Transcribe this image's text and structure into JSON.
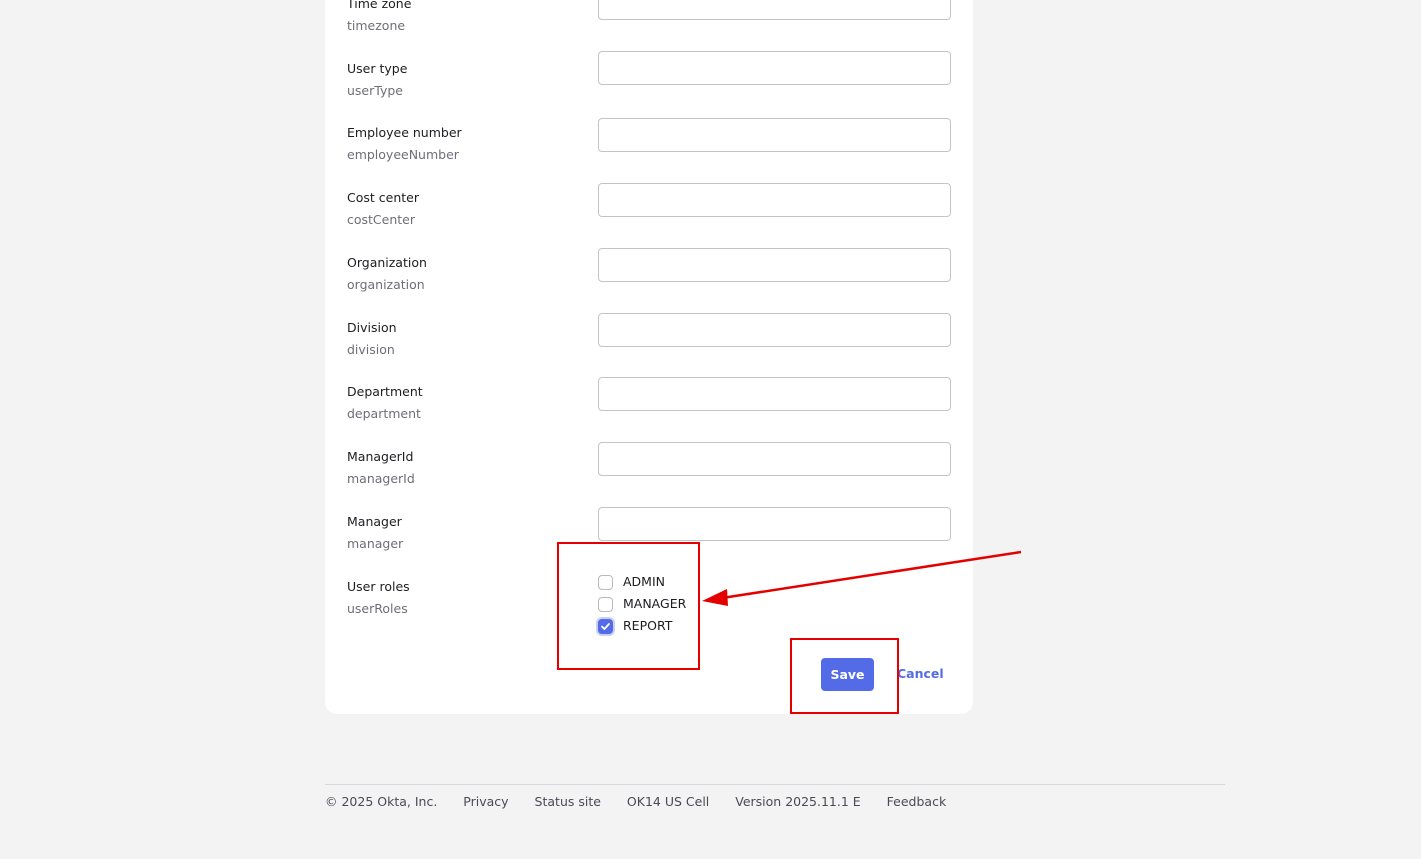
{
  "form": {
    "fields": [
      {
        "label": "Time zone",
        "var": "timezone",
        "value": ""
      },
      {
        "label": "User type",
        "var": "userType",
        "value": ""
      },
      {
        "label": "Employee number",
        "var": "employeeNumber",
        "value": ""
      },
      {
        "label": "Cost center",
        "var": "costCenter",
        "value": ""
      },
      {
        "label": "Organization",
        "var": "organization",
        "value": ""
      },
      {
        "label": "Division",
        "var": "division",
        "value": ""
      },
      {
        "label": "Department",
        "var": "department",
        "value": ""
      },
      {
        "label": "ManagerId",
        "var": "managerId",
        "value": ""
      },
      {
        "label": "Manager",
        "var": "manager",
        "value": ""
      }
    ],
    "user_roles": {
      "label": "User roles",
      "var": "userRoles",
      "options": [
        {
          "label": "ADMIN",
          "checked": false
        },
        {
          "label": "MANAGER",
          "checked": false
        },
        {
          "label": "REPORT",
          "checked": true
        }
      ]
    },
    "save_label": "Save",
    "cancel_label": "Cancel"
  },
  "footer": {
    "copyright": "© 2025 Okta, Inc.",
    "links": [
      "Privacy",
      "Status site",
      "OK14 US Cell",
      "Version 2025.11.1 E",
      "Feedback"
    ]
  },
  "colors": {
    "accent": "#546be7",
    "annotation": "#e50000",
    "page_bg": "#f3f3f3"
  }
}
